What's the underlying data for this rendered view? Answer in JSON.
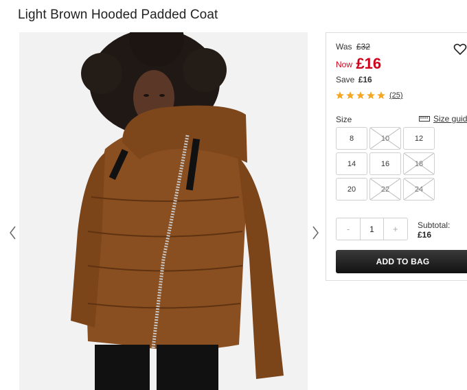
{
  "product": {
    "title": "Light Brown Hooded Padded Coat",
    "image_alt": "Model wearing a light brown hooded padded coat"
  },
  "pricing": {
    "was_label": "Was",
    "was_price": "£32",
    "now_label": "Now",
    "now_price": "£16",
    "save_label": "Save",
    "save_amount": "£16",
    "accent_color": "#d0021b"
  },
  "rating": {
    "stars": 5,
    "reviews": "(25)",
    "star_color": "#f5a623"
  },
  "size": {
    "label": "Size",
    "guide_label": "Size guide",
    "options": [
      {
        "label": "8",
        "available": true
      },
      {
        "label": "10",
        "available": false
      },
      {
        "label": "12",
        "available": true
      },
      {
        "label": "14",
        "available": true
      },
      {
        "label": "16",
        "available": true
      },
      {
        "label": "18",
        "available": false
      },
      {
        "label": "20",
        "available": true
      },
      {
        "label": "22",
        "available": false
      },
      {
        "label": "24",
        "available": false
      }
    ]
  },
  "quantity": {
    "minus": "-",
    "value": "1",
    "plus": "+"
  },
  "subtotal": {
    "label": "Subtotal:",
    "value": "£16"
  },
  "cta": {
    "add_to_bag": "ADD TO BAG"
  },
  "icons": {
    "wishlist": "heart-icon",
    "prev": "chevron-left-icon",
    "next": "chevron-right-icon",
    "size_guide": "ruler-icon"
  }
}
